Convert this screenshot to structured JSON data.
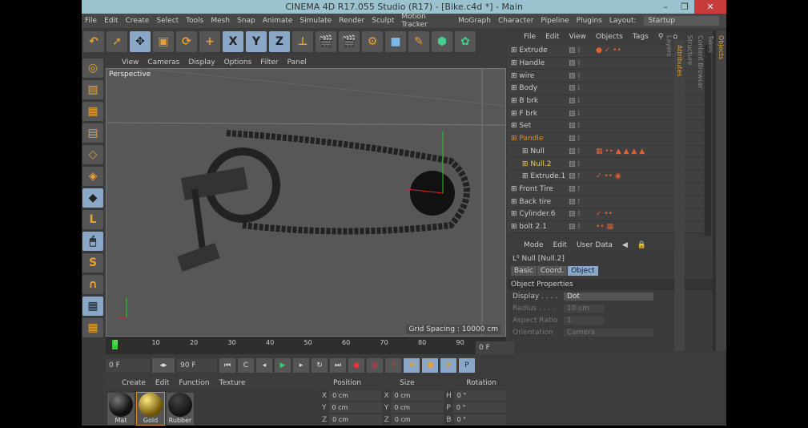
{
  "title": "CINEMA 4D R17.055 Studio (R17) - [Bike.c4d *] - Main",
  "menu": [
    "File",
    "Edit",
    "Create",
    "Select",
    "Tools",
    "Mesh",
    "Snap",
    "Animate",
    "Simulate",
    "Render",
    "Sculpt",
    "Motion Tracker",
    "MoGraph",
    "Character",
    "Pipeline",
    "Plugins"
  ],
  "layout_label": "Layout:",
  "layout_value": "Startup",
  "viewport": {
    "menu": [
      "View",
      "Cameras",
      "Display",
      "Options",
      "Filter",
      "Panel"
    ],
    "camera": "Perspective",
    "grid": "Grid Spacing : 10000 cm"
  },
  "objects": {
    "menu": [
      "File",
      "Edit",
      "View",
      "Objects",
      "Tags"
    ],
    "rows": [
      {
        "name": "Extrude",
        "tags": "● ✓ ••"
      },
      {
        "name": "Handle",
        "tags": ""
      },
      {
        "name": "wire",
        "tags": ""
      },
      {
        "name": "Body",
        "tags": ""
      },
      {
        "name": "B brk",
        "tags": ""
      },
      {
        "name": "F brk",
        "tags": ""
      },
      {
        "name": "Set",
        "tags": ""
      },
      {
        "name": "Pandle",
        "tags": ""
      },
      {
        "name": "Null",
        "tags": "▦ •• ▲ ▲ ▲ ▲"
      },
      {
        "name": "Null.2",
        "tags": ""
      },
      {
        "name": "Extrude.1",
        "tags": "✓ •• ◉"
      },
      {
        "name": "Front Tire",
        "tags": ""
      },
      {
        "name": "Back tire",
        "tags": ""
      },
      {
        "name": "Cylinder.6",
        "tags": "✓ ••"
      },
      {
        "name": "bolt 2.1",
        "tags": "•• ▦"
      }
    ]
  },
  "side_tabs": [
    "Objects",
    "Takes",
    "Content Browser",
    "Structure"
  ],
  "attributes": {
    "menu": [
      "Mode",
      "Edit",
      "User Data"
    ],
    "object": "Null [Null.2]",
    "tabs": [
      "Basic",
      "Coord.",
      "Object"
    ],
    "section": "Object Properties",
    "props": [
      {
        "label": "Display . . . .",
        "value": "Dot"
      },
      {
        "label": "Radius . . . .",
        "value": "10 cm"
      },
      {
        "label": "Aspect Ratio",
        "value": "1"
      },
      {
        "label": "Orientation",
        "value": "Camera"
      }
    ]
  },
  "side_tabs2": [
    "Attributes",
    "Layers"
  ],
  "timeline": {
    "ticks": [
      "0",
      "10",
      "20",
      "30",
      "40",
      "50",
      "60",
      "70",
      "80",
      "90"
    ],
    "current": "0 F",
    "start": "0 F",
    "end": "90 F"
  },
  "materials": {
    "menu": [
      "Create",
      "Edit",
      "Function",
      "Texture"
    ],
    "items": [
      "Mat",
      "Gold",
      "Rubber"
    ]
  },
  "coords": {
    "headers": [
      "Position",
      "Size",
      "Rotation"
    ],
    "rows": [
      [
        "X",
        "0 cm",
        "X",
        "0 cm",
        "H",
        "0 °"
      ],
      [
        "Y",
        "0 cm",
        "Y",
        "0 cm",
        "P",
        "0 °"
      ],
      [
        "Z",
        "0 cm",
        "Z",
        "0 cm",
        "B",
        "0 °"
      ]
    ]
  }
}
